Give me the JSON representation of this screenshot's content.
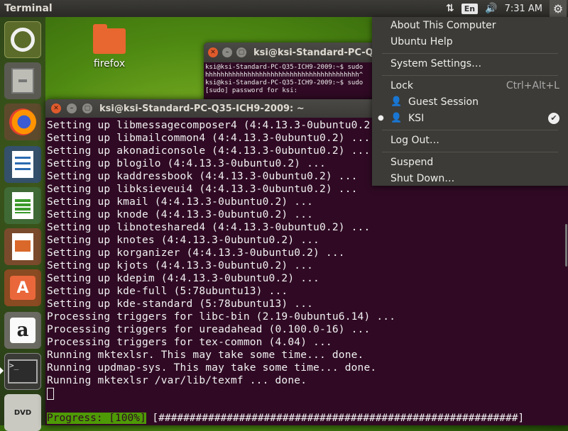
{
  "panel": {
    "app_title": "Terminal",
    "lang": "En",
    "clock": "7:31 AM"
  },
  "icons": {
    "network": "network-icon",
    "volume": "volume-icon",
    "session": "gear-icon"
  },
  "launcher": [
    {
      "name": "ubuntu-dash"
    },
    {
      "name": "files"
    },
    {
      "name": "firefox"
    },
    {
      "name": "libreoffice-writer"
    },
    {
      "name": "libreoffice-calc"
    },
    {
      "name": "libreoffice-impress"
    },
    {
      "name": "ubuntu-software"
    },
    {
      "name": "amazon"
    },
    {
      "name": "terminal"
    },
    {
      "name": "dvd"
    }
  ],
  "launcher_labels": {
    "amazon_glyph": "a",
    "software_glyph": "A",
    "terminal_glyph": ">_",
    "dvd_label": "DVD"
  },
  "desktop": {
    "folder_label": "firefox"
  },
  "back_terminal": {
    "title": "ksi@ksi-Standard-PC-Q",
    "lines": [
      "ksi@ksi-Standard-PC-Q35-ICH9-2009:~$ sudo",
      "hhhhhhhhhhhhhhhhhhhhhhhhhhhhhhhhhhhhhhhh^",
      "ksi@ksi-Standard-PC-Q35-ICH9-2009:~$ sudo",
      "[sudo] password for ksi:"
    ]
  },
  "terminal": {
    "title": "ksi@ksi-Standard-PC-Q35-ICH9-2009: ~",
    "lines": [
      "Setting up libmessagecomposer4 (4:4.13.3-0ubuntu0.2) ...",
      "Setting up libmailcommon4 (4:4.13.3-0ubuntu0.2) ...",
      "Setting up akonadiconsole (4:4.13.3-0ubuntu0.2) ...",
      "Setting up blogilo (4:4.13.3-0ubuntu0.2) ...",
      "Setting up kaddressbook (4:4.13.3-0ubuntu0.2) ...",
      "Setting up libksieveui4 (4:4.13.3-0ubuntu0.2) ...",
      "Setting up kmail (4:4.13.3-0ubuntu0.2) ...",
      "Setting up knode (4:4.13.3-0ubuntu0.2) ...",
      "Setting up libnoteshared4 (4:4.13.3-0ubuntu0.2) ...",
      "Setting up knotes (4:4.13.3-0ubuntu0.2) ...",
      "Setting up korganizer (4:4.13.3-0ubuntu0.2) ...",
      "Setting up kjots (4:4.13.3-0ubuntu0.2) ...",
      "Setting up kdepim (4:4.13.3-0ubuntu0.2) ...",
      "Setting up kde-full (5:78ubuntu13) ...",
      "Setting up kde-standard (5:78ubuntu13) ...",
      "Processing triggers for libc-bin (2.19-0ubuntu6.14) ...",
      "Processing triggers for ureadahead (0.100.0-16) ...",
      "Processing triggers for tex-common (4.04) ...",
      "Running mktexlsr. This may take some time... done.",
      "Running updmap-sys. This may take some time... done.",
      "Running mktexlsr /var/lib/texmf ... done."
    ],
    "progress_label": "Progress: [100%]",
    "progress_bar": " [##########################################################]"
  },
  "session_menu": {
    "about": "About This Computer",
    "help": "Ubuntu Help",
    "settings": "System Settings…",
    "lock": "Lock",
    "lock_shortcut": "Ctrl+Alt+L",
    "guest": "Guest Session",
    "user": "KSI",
    "logout": "Log Out…",
    "suspend": "Suspend",
    "shutdown": "Shut Down…"
  },
  "colors": {
    "terminal_bg": "#300a24",
    "panel_bg": "#3c3b37",
    "progress_green": "#4e9a06",
    "close_orange": "#e05a2c"
  }
}
